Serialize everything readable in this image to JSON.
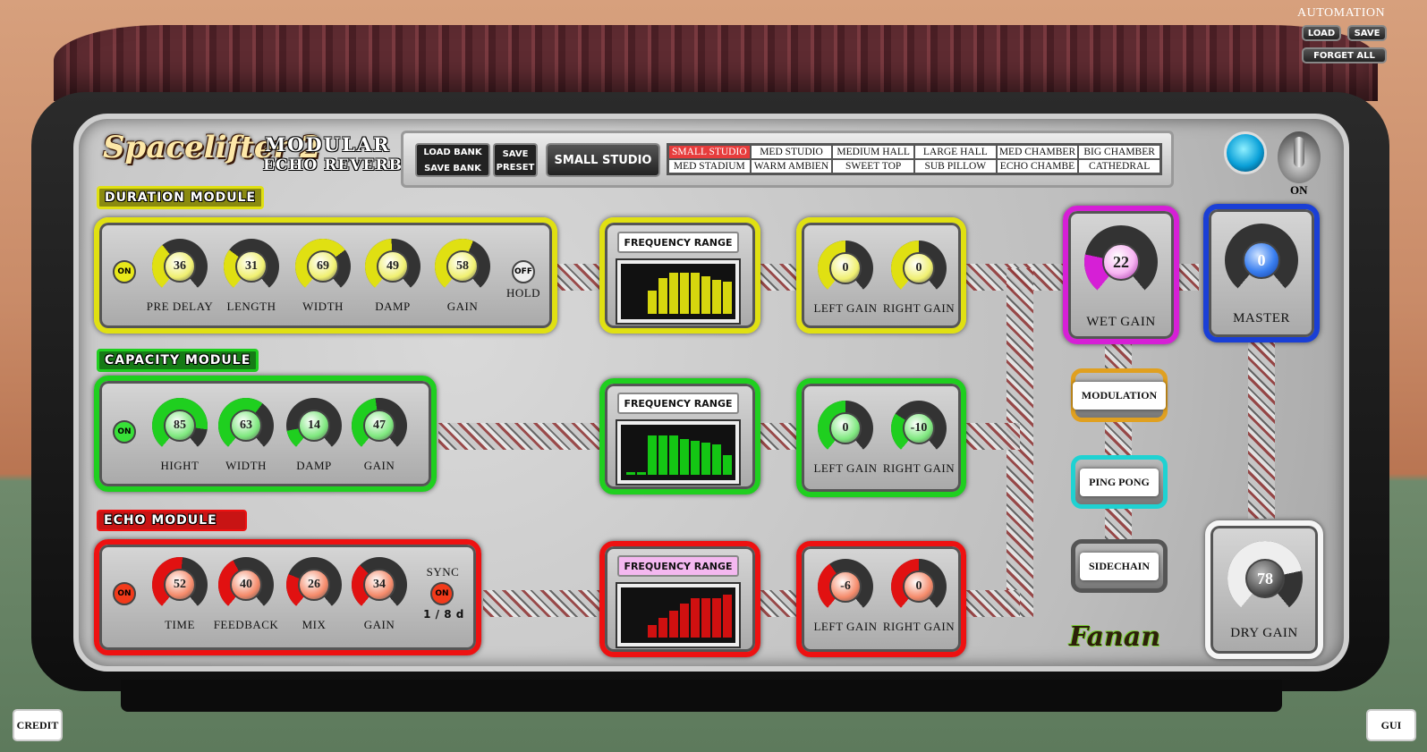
{
  "automation": {
    "title": "AUTOMATION",
    "load": "LOAD",
    "save": "SAVE",
    "forget": "FORGET ALL"
  },
  "logo": {
    "name": "Spacelifter 2",
    "subtitle1": "MODULAR",
    "subtitle2": "ECHO REVERB"
  },
  "bank": {
    "load": "LOAD BANK",
    "save": "SAVE BANK",
    "save_preset_1": "SAVE",
    "save_preset_2": "PRESET",
    "current": "SMALL STUDIO"
  },
  "presets": [
    "SMALL STUDIO",
    "MED STUDIO",
    "MEDIUM HALL",
    "LARGE HALL",
    "MED CHAMBER",
    "BIG CHAMBER",
    "MED STADIUM",
    "WARM AMBIEN",
    "SWEET TOP",
    "SUB PILLOW",
    "ECHO CHAMBE",
    "CATHEDRAL"
  ],
  "power": {
    "label": "ON"
  },
  "duration": {
    "title": "DURATION MODULE",
    "on": "ON",
    "hold": "OFF",
    "hold_label": "HOLD",
    "knobs": [
      {
        "value": "36",
        "label": "PRE DELAY"
      },
      {
        "value": "31",
        "label": "LENGTH"
      },
      {
        "value": "69",
        "label": "WIDTH"
      },
      {
        "value": "49",
        "label": "DAMP"
      },
      {
        "value": "58",
        "label": "GAIN"
      }
    ],
    "freq_title": "FREQUENCY RANGE",
    "gains": [
      {
        "value": "0",
        "label": "LEFT GAIN"
      },
      {
        "value": "0",
        "label": "RIGHT GAIN"
      }
    ]
  },
  "capacity": {
    "title": "CAPACITY MODULE",
    "on": "ON",
    "knobs": [
      {
        "value": "85",
        "label": "HIGHT"
      },
      {
        "value": "63",
        "label": "WIDTH"
      },
      {
        "value": "14",
        "label": "DAMP"
      },
      {
        "value": "47",
        "label": "GAIN"
      }
    ],
    "freq_title": "FREQUENCY RANGE",
    "gains": [
      {
        "value": "0",
        "label": "LEFT GAIN"
      },
      {
        "value": "-10",
        "label": "RIGHT GAIN"
      }
    ]
  },
  "echo": {
    "title": "ECHO MODULE",
    "on": "ON",
    "sync_label": "SYNC",
    "sync": "ON",
    "division": "1 / 8 d",
    "knobs": [
      {
        "value": "52",
        "label": "TIME"
      },
      {
        "value": "40",
        "label": "FEEDBACK"
      },
      {
        "value": "26",
        "label": "MIX"
      },
      {
        "value": "34",
        "label": "GAIN"
      }
    ],
    "freq_title": "FREQUENCY RANGE",
    "gains": [
      {
        "value": "-6",
        "label": "LEFT GAIN"
      },
      {
        "value": "0",
        "label": "RIGHT GAIN"
      }
    ]
  },
  "wet": {
    "value": "22",
    "label": "WET GAIN"
  },
  "master": {
    "value": "0",
    "label": "MASTER"
  },
  "dry": {
    "value": "78",
    "label": "DRY GAIN"
  },
  "fx": {
    "modulation": "MODULATION",
    "pingpong": "PING PONG",
    "sidechain": "SIDECHAIN"
  },
  "brand": "Fanan",
  "credit": "CREDIT",
  "gui": "GUI",
  "colors": {
    "yellow": "#e0e012",
    "green": "#1fcf1f",
    "red": "#e11111",
    "magenta": "#d61fd6",
    "blue": "#1a3fd6"
  }
}
